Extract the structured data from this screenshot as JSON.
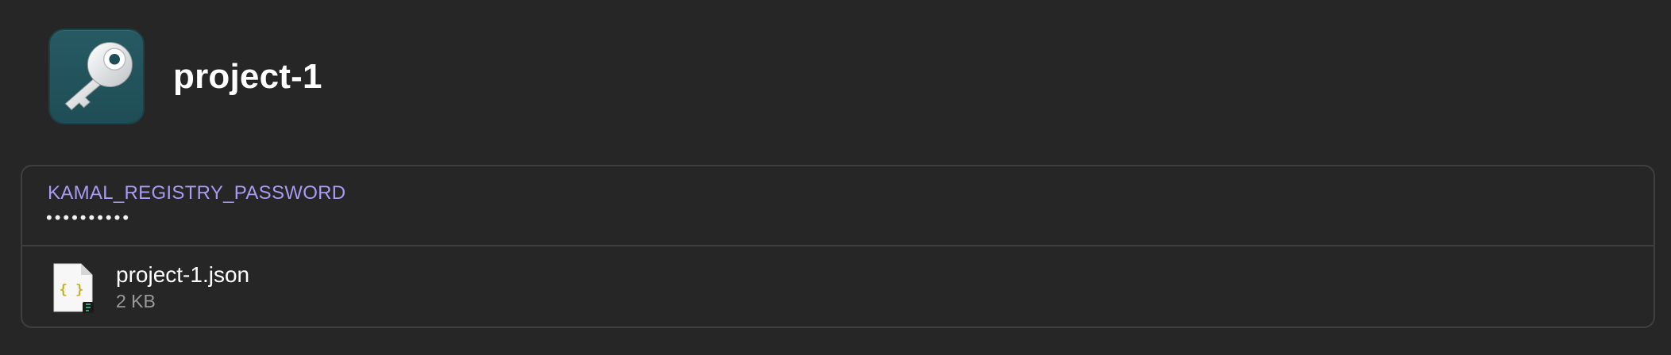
{
  "item": {
    "title": "project-1",
    "icon": "key-icon",
    "icon_bg": "#265a63"
  },
  "fields": [
    {
      "label": "KAMAL_REGISTRY_PASSWORD",
      "value": "••••••••••",
      "label_color": "#a99af5"
    }
  ],
  "attachments": [
    {
      "icon": "json-file-icon",
      "icon_glyph": "{ }",
      "name": "project-1.json",
      "size": "2 KB"
    }
  ],
  "colors": {
    "background": "#262626",
    "border": "#3f3f3f",
    "text": "#ffffff",
    "muted": "#9a9a9a"
  }
}
